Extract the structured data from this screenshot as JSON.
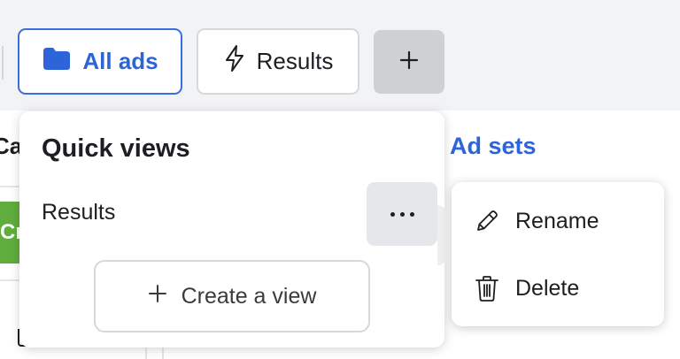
{
  "tabs": [
    {
      "label": "All ads",
      "icon": "folder-icon",
      "active": true
    },
    {
      "label": "Results",
      "icon": "lightning-icon",
      "active": false
    }
  ],
  "add_button": {
    "icon": "plus-icon"
  },
  "background": {
    "left_fragment_title": "Car",
    "left_fragment_button": "Cr",
    "ad_sets_label": "Ad sets"
  },
  "quick_views": {
    "title": "Quick views",
    "views": [
      {
        "label": "Results",
        "more_icon": "more-horizontal-icon"
      }
    ],
    "create_button_label": "Create a view"
  },
  "context_menu": {
    "items": [
      {
        "label": "Rename",
        "icon": "pencil-icon"
      },
      {
        "label": "Delete",
        "icon": "trash-icon"
      }
    ]
  },
  "colors": {
    "accent": "#2d64d7",
    "green_button": "#5fae3d",
    "page_bg": "#f2f3f5"
  }
}
